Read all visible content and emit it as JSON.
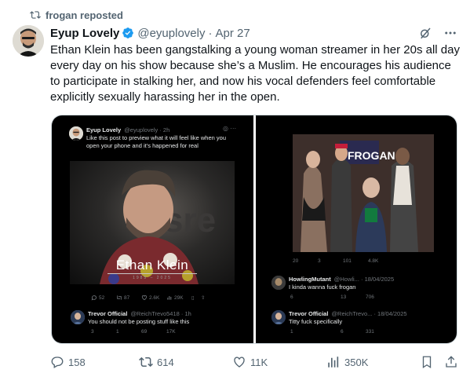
{
  "repost": {
    "label": "frogan reposted"
  },
  "tweet": {
    "author_name": "Eyup Lovely",
    "handle": "@eyuplovely",
    "separator": "·",
    "date": "Apr 27",
    "text": "Ethan Klein has been gangstalking a young woman streamer in her 20s all day every day on his show because she’s a Muslim. He encourages his audience to participate in stalking her, and now his vocal defenders feel comfortable explicitly sexually harassing her in the open."
  },
  "media": {
    "left": {
      "quote_author": "Eyup Lovely",
      "quote_handle": "@eyuplovely · 2h",
      "quote_text": "Like this post to preview what it will feel like when you open your phone and it’s happened for real",
      "photo_caption": "Ethan  Klein",
      "photo_years": "1985 – 2025",
      "quote_counts": [
        "52",
        "87",
        "2.6K",
        "29K"
      ],
      "reply_author": "Trevor Official",
      "reply_handle": "@ReichTrevo5418 · 1h",
      "reply_text": "You should not be posting stuff like this",
      "reply_counts": [
        "3",
        "1",
        "69",
        "17K"
      ]
    },
    "right": {
      "photo_sign": "FROGAN",
      "post_counts": [
        "20",
        "3",
        "101",
        "4.8K"
      ],
      "reply1_author": "HowlingMutant",
      "reply1_handle": "@Howli... · 18/04/2025",
      "reply1_text": "I kinda wanna fuck frogan",
      "reply1_counts": [
        "6",
        "",
        "13",
        "706"
      ],
      "reply2_author": "Trevor Official",
      "reply2_handle": "@ReichTrevo... · 18/04/2025",
      "reply2_text": "Titty fuck specifically",
      "reply2_counts": [
        "1",
        "",
        "6",
        "331"
      ]
    }
  },
  "actions": {
    "replies": "158",
    "reposts": "614",
    "likes": "11K",
    "views": "350K"
  },
  "colors": {
    "text": "#0f1419",
    "secondary": "#536471",
    "verified": "#1d9bf0",
    "repost_green": "#00ba7c"
  }
}
